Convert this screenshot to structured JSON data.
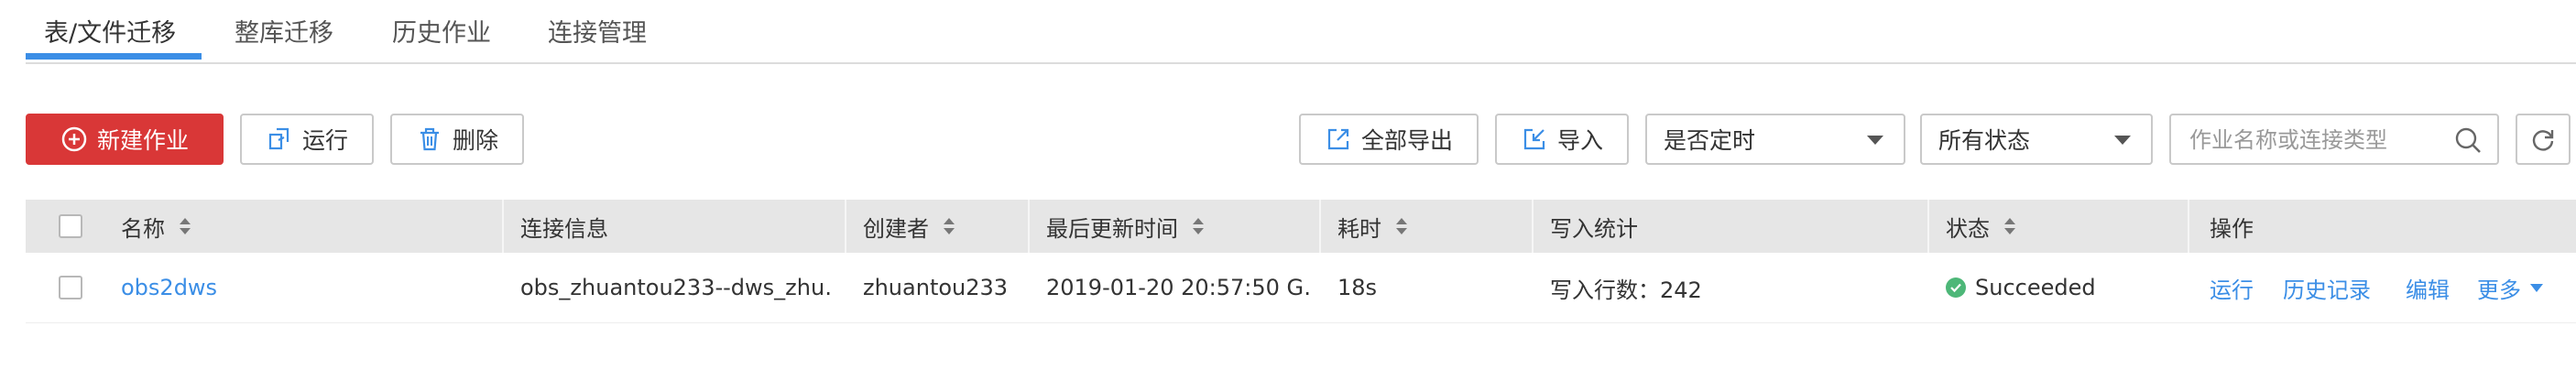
{
  "tabs": [
    {
      "label": "表/文件迁移",
      "active": true
    },
    {
      "label": "整库迁移"
    },
    {
      "label": "历史作业"
    },
    {
      "label": "连接管理"
    }
  ],
  "toolbar": {
    "new_job": "新建作业",
    "run": "运行",
    "delete": "删除",
    "export_all": "全部导出",
    "import": "导入",
    "schedule_filter": "是否定时",
    "status_filter": "所有状态",
    "search_placeholder": "作业名称或连接类型",
    "accent_color": "#d93737"
  },
  "table": {
    "columns": [
      "名称",
      "连接信息",
      "创建者",
      "最后更新时间",
      "耗时",
      "写入统计",
      "状态",
      "操作"
    ],
    "rows": [
      {
        "name": "obs2dws",
        "connection": "obs_zhuantou233--dws_zhu…",
        "creator": "zhuantou233",
        "updated": "2019-01-20 20:57:50 G…",
        "duration": "18s",
        "write_stats": "写入行数：242",
        "status": "Succeeded",
        "status_color": "#4db778",
        "actions": [
          "运行",
          "历史记录",
          "编辑",
          "更多"
        ]
      }
    ]
  },
  "link_color": "#3b8ee6"
}
